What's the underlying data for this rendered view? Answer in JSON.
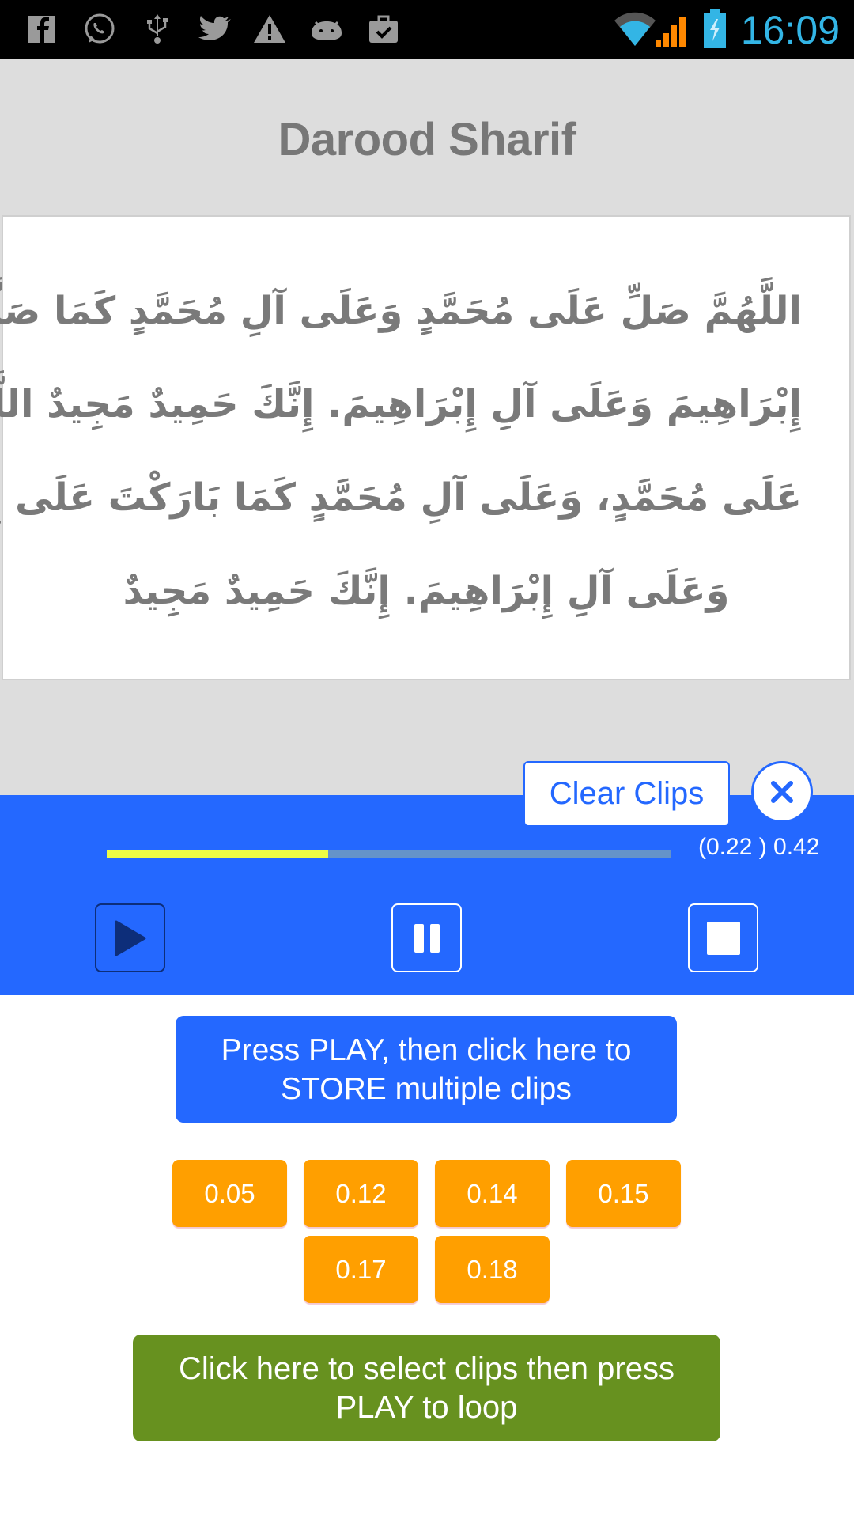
{
  "status_bar": {
    "notification_icons": [
      "facebook-icon",
      "whatsapp-icon",
      "usb-icon",
      "twitter-icon",
      "warning-icon",
      "android-debug-icon",
      "task-done-icon"
    ],
    "system_icons": [
      "wifi-icon",
      "cell-signal-icon",
      "battery-charging-icon"
    ],
    "time": "16:09",
    "colors": {
      "clock": "#33b5e5",
      "signal": "#ff8800"
    }
  },
  "header": {
    "title": "Darood Sharif"
  },
  "prayer": {
    "lines": [
      "اللَّهُمَّ صَلِّ عَلَى مُحَمَّدٍ وَعَلَى آلِ مُحَمَّدٍ كَمَا صَلَّيْتَ عَلَى",
      "إِبْرَاهِيمَ وَعَلَى آلِ إِبْرَاهِيمَ. إِنَّكَ حَمِيدٌ مَجِيدٌ اللَّهُمَّ بَارِكْ",
      "عَلَى مُحَمَّدٍ، وَعَلَى آلِ مُحَمَّدٍ كَمَا بَارَكْتَ عَلَى إِبْرَاهِيمَ",
      "وَعَلَى آلِ إِبْرَاهِيمَ. إِنَّكَ حَمِيدٌ مَجِيدٌ"
    ]
  },
  "player": {
    "clear_clips_label": "Clear Clips",
    "close_icon": "close-icon",
    "progress_fraction": 0.392,
    "time_readout": "(0.22 ) 0.42",
    "controls": [
      {
        "name": "play",
        "icon": "play-icon"
      },
      {
        "name": "pause",
        "icon": "pause-icon"
      },
      {
        "name": "stop",
        "icon": "stop-icon"
      }
    ],
    "colors": {
      "background": "#2468ff",
      "progress_fill": "#eefc44",
      "progress_track": "#6593c9"
    }
  },
  "store_button": {
    "line1": "Press PLAY, then click here to",
    "line2": "STORE multiple clips"
  },
  "clips": [
    "0.05",
    "0.12",
    "0.14",
    "0.15",
    "0.17",
    "0.18"
  ],
  "loop_button": {
    "line1": "Click here to select clips then press",
    "line2": "PLAY to loop"
  },
  "colors": {
    "clip": "#ff9f00",
    "loop": "#67911f",
    "header_bg": "#dddddd"
  }
}
